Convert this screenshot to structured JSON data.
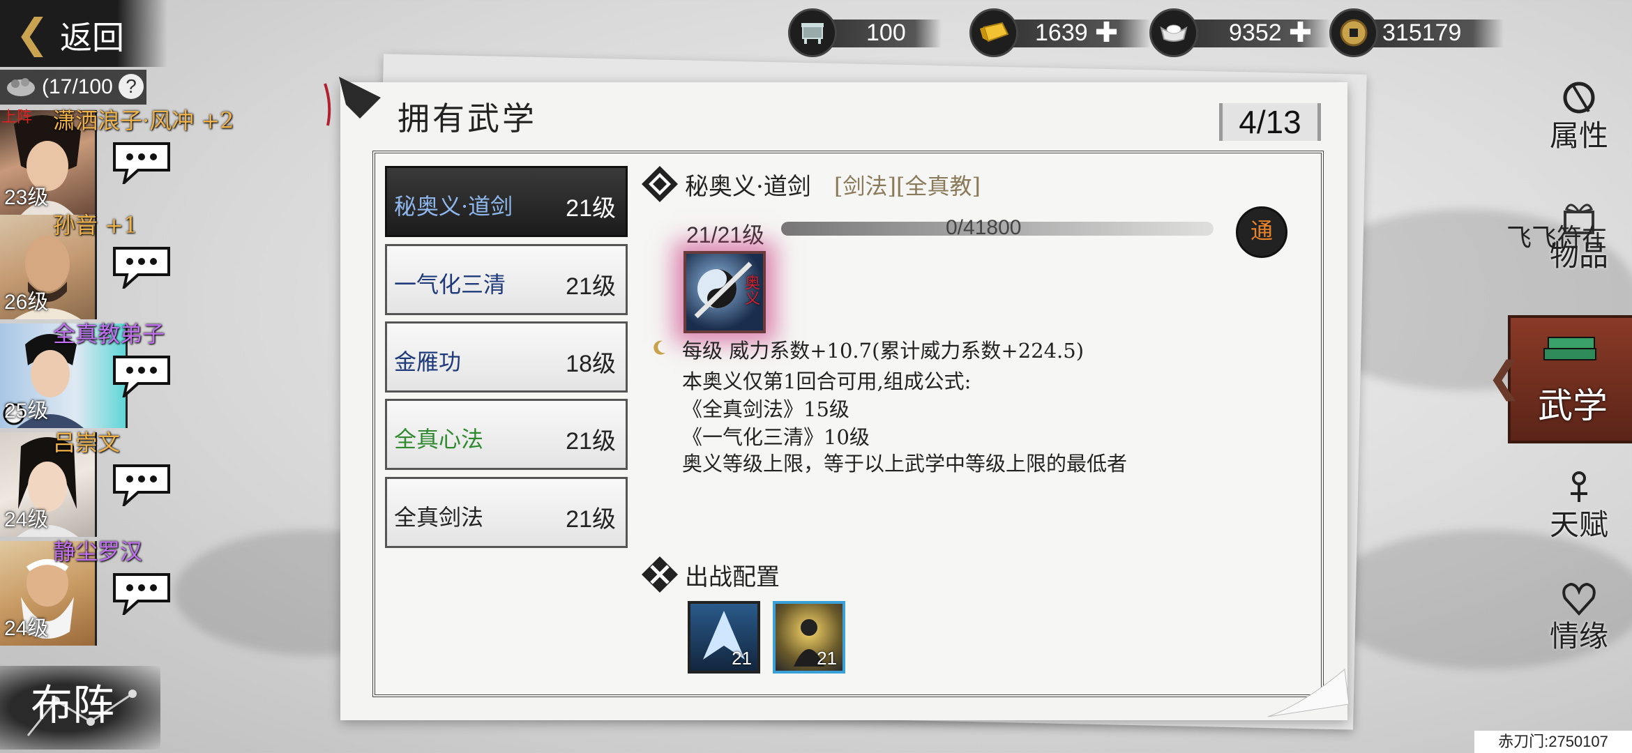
{
  "currencies": [
    {
      "icon": "ding-vessel-icon",
      "value": "100",
      "plus": false
    },
    {
      "icon": "gold-bar-icon",
      "value": "1639",
      "plus": true
    },
    {
      "icon": "silver-ingot-icon",
      "value": "9352",
      "plus": true
    },
    {
      "icon": "copper-coin-icon",
      "value": "315179",
      "plus": false
    }
  ],
  "nav": {
    "back_label": "返回",
    "roster_count": "(17/100",
    "help": "?"
  },
  "heroes": [
    {
      "name": "潇洒浪子·风冲 +2",
      "level": "23级",
      "name_color": "#f0b34a",
      "onstage": "上阵"
    },
    {
      "name": "孙音 +1",
      "level": "26级",
      "name_color": "#f0b34a",
      "onstage": ""
    },
    {
      "name": "全真教弟子",
      "level": "25级",
      "name_color": "#c070f0",
      "onstage": ""
    },
    {
      "name": "吕崇文",
      "level": "24级",
      "name_color": "#f0b34a",
      "onstage": ""
    },
    {
      "name": "静尘罗汉",
      "level": "24级",
      "name_color": "#c070f0",
      "onstage": ""
    }
  ],
  "formation_label": "布阵",
  "panel": {
    "title": "拥有武学",
    "page": "4/13"
  },
  "skills": [
    {
      "name": "秘奥义·道剑",
      "level": "21级",
      "color": "#8fb8ef",
      "active": true
    },
    {
      "name": "一气化三清",
      "level": "21级",
      "color": "#1e3a7a",
      "active": false
    },
    {
      "name": "金雁功",
      "level": "18级",
      "color": "#1e3a7a",
      "active": false
    },
    {
      "name": "全真心法",
      "level": "21级",
      "color": "#2f8a2f",
      "active": false
    },
    {
      "name": "全真剑法",
      "level": "21级",
      "color": "#222222",
      "active": false
    }
  ],
  "detail": {
    "title": "秘奥义·道剑",
    "tags": "[剑法][全真教]",
    "level_progress": "21/21级",
    "xp": "0/41800",
    "xp_fraction": 0,
    "badge": "通",
    "icon_label": "奥义",
    "lines": [
      "每级   威力系数+10.7(累计威力系数+224.5)",
      "本奥义仅第1回合可用,组成公式:",
      "《全真剑法》15级",
      "《一气化三清》10级",
      "奥义等级上限，等于以上武学中等级上限的最低者"
    ],
    "loadout_title": "出战配置",
    "loadout": [
      {
        "level": "21"
      },
      {
        "level": "21"
      }
    ]
  },
  "tabs": [
    {
      "label": "属性",
      "active": false
    },
    {
      "label": "物品",
      "active": false
    },
    {
      "label": "武学",
      "active": true
    },
    {
      "label": "天赋",
      "active": false
    },
    {
      "label": "情缘",
      "active": false
    }
  ],
  "marquee_text": "飞飞符在",
  "footer": "赤刀门:2750107"
}
